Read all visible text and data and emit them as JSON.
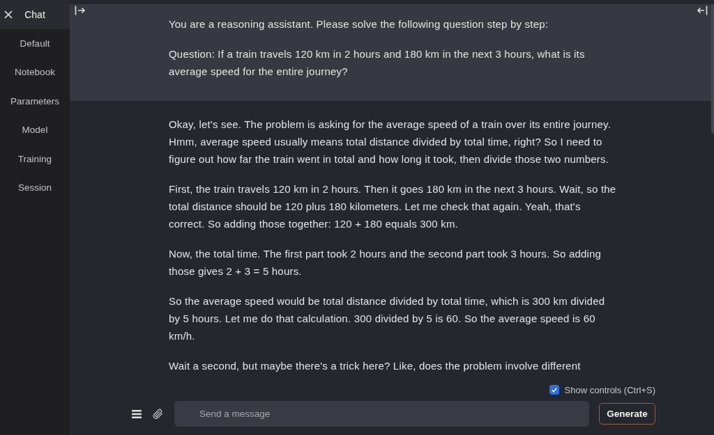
{
  "sidebar": {
    "tabs": [
      {
        "label": "Chat",
        "selected": true
      },
      {
        "label": "Default",
        "selected": false
      },
      {
        "label": "Notebook",
        "selected": false
      },
      {
        "label": "Parameters",
        "selected": false
      },
      {
        "label": "Model",
        "selected": false
      },
      {
        "label": "Training",
        "selected": false
      },
      {
        "label": "Session",
        "selected": false
      }
    ]
  },
  "messages": [
    {
      "kind": "user",
      "paragraphs": [
        "You are a reasoning assistant. Please solve the following question step by step:",
        "Question: If a train travels 120 km in 2 hours and 180 km in the next 3 hours, what is its average speed for the entire journey?"
      ]
    },
    {
      "kind": "assistant",
      "paragraphs": [
        "Okay, let's see. The problem is asking for the average speed of a train over its entire journey. Hmm, average speed usually means total distance divided by total time, right? So I need to figure out how far the train went in total and how long it took, then divide those two numbers.",
        "First, the train travels 120 km in 2 hours. Then it goes 180 km in the next 3 hours. Wait, so the total distance should be 120 plus 180 kilometers. Let me check that again. Yeah, that's correct. So adding those together: 120 + 180 equals 300 km.",
        "Now, the total time. The first part took 2 hours and the second part took 3 hours. So adding those gives 2 + 3 = 5 hours.",
        "So the average speed would be total distance divided by total time, which is 300 km divided by 5 hours. Let me do that calculation. 300 divided by 5 is 60. So the average speed is 60 km/h.",
        "Wait a second, but maybe there's a trick here? Like, does the problem involve different"
      ]
    }
  ],
  "show_controls": {
    "label": "Show controls (Ctrl+S)",
    "checked": true
  },
  "message_input": {
    "placeholder": "Send a message"
  },
  "generate_button": {
    "label": "Generate"
  }
}
